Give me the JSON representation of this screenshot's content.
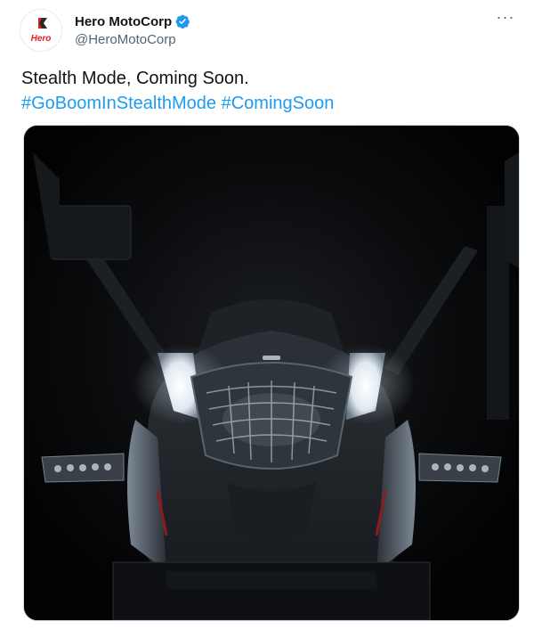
{
  "author": {
    "display_name": "Hero MotoCorp",
    "handle": "@HeroMotoCorp",
    "avatar_logo_text": "Hero",
    "verified": true
  },
  "tweet": {
    "text_line": "Stealth Mode, Coming Soon.",
    "hashtags": [
      "#GoBoomInStealthMode",
      "#ComingSoon"
    ]
  },
  "media": {
    "description_icon": "motorcycle-headlight-image"
  },
  "colors": {
    "link": "#1d9bf0",
    "verified": "#1d9bf0",
    "brand_red": "#e31e24"
  }
}
